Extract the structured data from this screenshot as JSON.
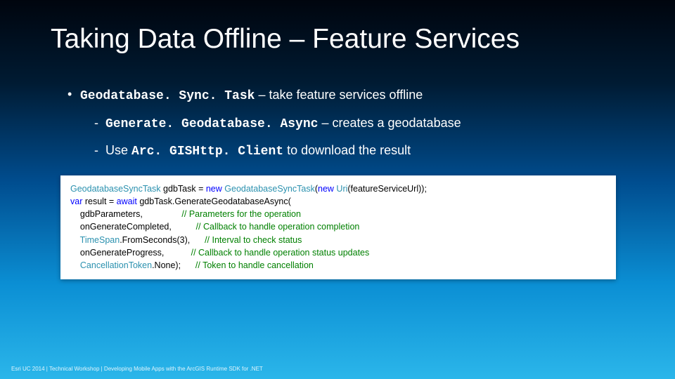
{
  "title": "Taking Data Offline – Feature Services",
  "b1_code": "Geodatabase. Sync. Task",
  "b1_rest": " – take feature services offline",
  "b1a_code": "Generate. Geodatabase. Async",
  "b1a_rest": " – creates a geodatabase",
  "b1b_pre": "Use ",
  "b1b_code": "Arc. GISHttp. Client",
  "b1b_rest": " to download the result",
  "code": {
    "l1_type1": "GeodatabaseSyncTask",
    "l1_mid": " gdbTask = ",
    "l1_kw": "new",
    "l1_type2": "GeodatabaseSyncTask",
    "l1_open": "(",
    "l1_kw2": "new",
    "l1_type3": "Uri",
    "l1_tail": "(featureServiceUrl));",
    "l2_kw": "var",
    "l2_mid": " result = ",
    "l2_kw2": "await",
    "l2_tail": " gdbTask.GenerateGeodatabaseAsync(",
    "l3_arg": "    gdbParameters,                ",
    "l3_cmt": "// Parameters for the operation",
    "l4_arg": "    onGenerateCompleted,          ",
    "l4_cmt": "// Callback to handle operation completion",
    "l5_pre": "    ",
    "l5_type": "TimeSpan",
    "l5_mid": ".FromSeconds(3),      ",
    "l5_cmt": "// Interval to check status",
    "l6_arg": "    onGenerateProgress,           ",
    "l6_cmt": "// Callback to handle operation status updates",
    "l7_pre": "    ",
    "l7_type": "CancellationToken",
    "l7_mid": ".None);      ",
    "l7_cmt": "// Token to handle cancellation"
  },
  "footer": "Esri UC 2014 | Technical Workshop | Developing Mobile Apps with the ArcGIS Runtime SDK for .NET"
}
